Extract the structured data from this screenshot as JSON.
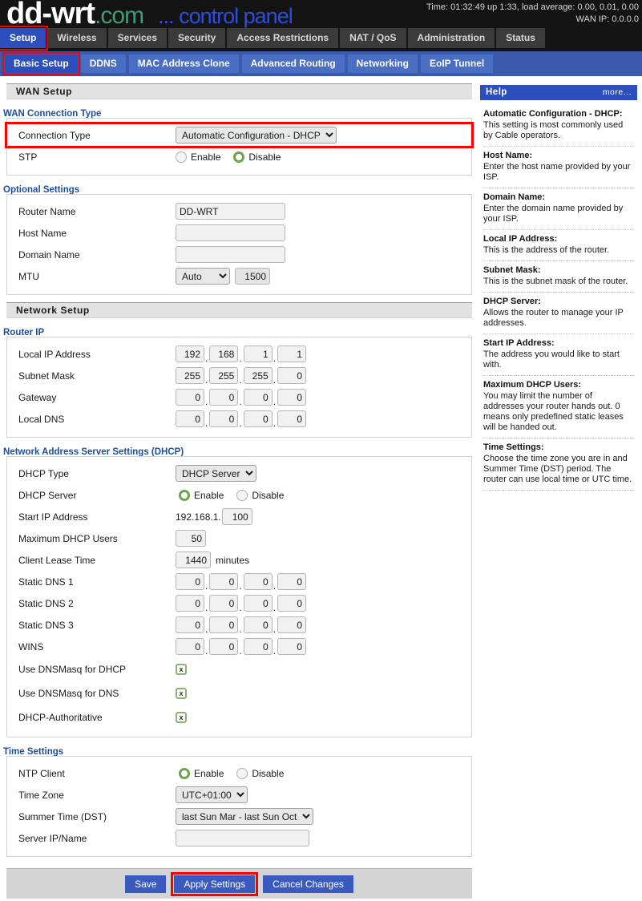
{
  "brand": {
    "name_main": "dd-wrt",
    "name_com": ".com",
    "tagline": "... control panel"
  },
  "sysinfo": {
    "time_line": "Time: 01:32:49 up 1:33, load average: 0.00, 0.01, 0.00",
    "wan_line": "WAN IP: 0.0.0.0"
  },
  "main_tabs": [
    {
      "label": "Setup"
    },
    {
      "label": "Wireless"
    },
    {
      "label": "Services"
    },
    {
      "label": "Security"
    },
    {
      "label": "Access Restrictions"
    },
    {
      "label": "NAT / QoS"
    },
    {
      "label": "Administration"
    },
    {
      "label": "Status"
    }
  ],
  "sub_tabs": [
    {
      "label": "Basic Setup"
    },
    {
      "label": "DDNS"
    },
    {
      "label": "MAC Address Clone"
    },
    {
      "label": "Advanced Routing"
    },
    {
      "label": "Networking"
    },
    {
      "label": "EoIP Tunnel"
    }
  ],
  "sections": {
    "wan_setup": "WAN Setup",
    "network_setup": "Network Setup"
  },
  "wan_connection_type": {
    "legend": "WAN Connection Type",
    "connection_type_label": "Connection Type",
    "connection_type_value": "Automatic Configuration - DHCP",
    "stp_label": "STP",
    "stp_enable": "Enable",
    "stp_disable": "Disable",
    "stp_selected": "Disable"
  },
  "optional_settings": {
    "legend": "Optional Settings",
    "router_name_label": "Router Name",
    "router_name_value": "DD-WRT",
    "host_name_label": "Host Name",
    "host_name_value": "",
    "domain_name_label": "Domain Name",
    "domain_name_value": "",
    "mtu_label": "MTU",
    "mtu_mode": "Auto",
    "mtu_value": "1500"
  },
  "router_ip": {
    "legend": "Router IP",
    "local_ip_label": "Local IP Address",
    "local_ip": [
      "192",
      "168",
      "1",
      "1"
    ],
    "subnet_label": "Subnet Mask",
    "subnet": [
      "255",
      "255",
      "255",
      "0"
    ],
    "gateway_label": "Gateway",
    "gateway": [
      "0",
      "0",
      "0",
      "0"
    ],
    "local_dns_label": "Local DNS",
    "local_dns": [
      "0",
      "0",
      "0",
      "0"
    ]
  },
  "dhcp": {
    "legend": "Network Address Server Settings (DHCP)",
    "dhcp_type_label": "DHCP Type",
    "dhcp_type_value": "DHCP Server",
    "dhcp_server_label": "DHCP Server",
    "dhcp_server_enable": "Enable",
    "dhcp_server_disable": "Disable",
    "dhcp_server_selected": "Enable",
    "start_ip_label": "Start IP Address",
    "start_ip_prefix": "192.168.1.",
    "start_ip_value": "100",
    "max_users_label": "Maximum DHCP Users",
    "max_users_value": "50",
    "lease_label": "Client Lease Time",
    "lease_value": "1440",
    "lease_unit": "minutes",
    "static_dns1_label": "Static DNS 1",
    "static_dns1": [
      "0",
      "0",
      "0",
      "0"
    ],
    "static_dns2_label": "Static DNS 2",
    "static_dns2": [
      "0",
      "0",
      "0",
      "0"
    ],
    "static_dns3_label": "Static DNS 3",
    "static_dns3": [
      "0",
      "0",
      "0",
      "0"
    ],
    "wins_label": "WINS",
    "wins": [
      "0",
      "0",
      "0",
      "0"
    ],
    "dnsmasq_dhcp_label": "Use DNSMasq for DHCP",
    "dnsmasq_dhcp_checked": true,
    "dnsmasq_dns_label": "Use DNSMasq for DNS",
    "dnsmasq_dns_checked": true,
    "dhcp_auth_label": "DHCP-Authoritative",
    "dhcp_auth_checked": true,
    "check_mark": "x"
  },
  "time_settings": {
    "legend": "Time Settings",
    "ntp_label": "NTP Client",
    "ntp_enable": "Enable",
    "ntp_disable": "Disable",
    "ntp_selected": "Enable",
    "timezone_label": "Time Zone",
    "timezone_value": "UTC+01:00",
    "dst_label": "Summer Time (DST)",
    "dst_value": "last Sun Mar - last Sun Oct",
    "server_label": "Server IP/Name",
    "server_value": ""
  },
  "buttons": {
    "save": "Save",
    "apply": "Apply Settings",
    "cancel": "Cancel Changes"
  },
  "help": {
    "title": "Help",
    "more": "more...",
    "items": [
      {
        "term": "Automatic Configuration - DHCP:",
        "desc": "This setting is most commonly used by Cable operators."
      },
      {
        "term": "Host Name:",
        "desc": "Enter the host name provided by your ISP."
      },
      {
        "term": "Domain Name:",
        "desc": "Enter the domain name provided by your ISP."
      },
      {
        "term": "Local IP Address:",
        "desc": "This is the address of the router."
      },
      {
        "term": "Subnet Mask:",
        "desc": "This is the subnet mask of the router."
      },
      {
        "term": "DHCP Server:",
        "desc": "Allows the router to manage your IP addresses."
      },
      {
        "term": "Start IP Address:",
        "desc": "The address you would like to start with."
      },
      {
        "term": "Maximum DHCP Users:",
        "desc": "You may limit the number of addresses your router hands out. 0 means only predefined static leases will be handed out."
      },
      {
        "term": "Time Settings:",
        "desc": "Choose the time zone you are in and Summer Time (DST) period. The router can use local time or UTC time."
      }
    ]
  },
  "colors": {
    "accent_blue": "#2c4fbd",
    "highlight_red": "#ff0000",
    "check_green": "#8cb46e",
    "radio_green": "#6fa34a",
    "header_black": "#141414"
  }
}
